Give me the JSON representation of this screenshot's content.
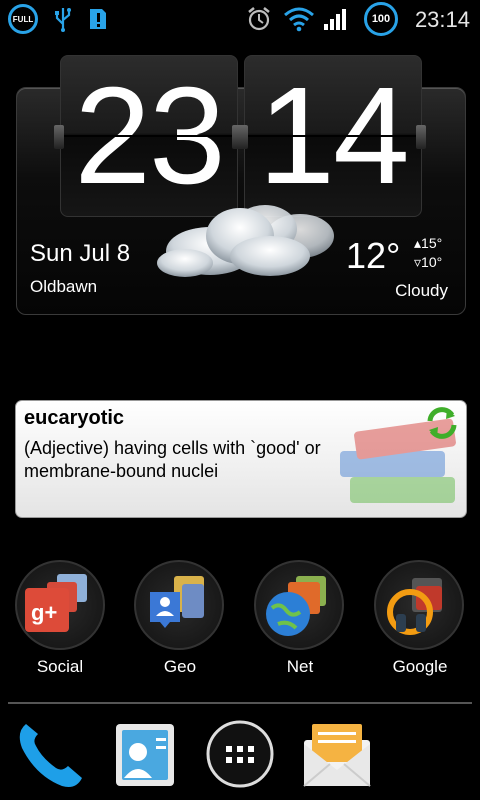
{
  "status_bar": {
    "battery_left_label": "FULL",
    "battery_right_label": "100",
    "time": "23:14",
    "icons": [
      "battery-full-icon",
      "usb-icon",
      "notification-alert-icon",
      "alarm-icon",
      "wifi-icon",
      "signal-icon"
    ]
  },
  "clock_widget": {
    "hours": "23",
    "minutes": "14",
    "date": "Sun Jul 8",
    "location": "Oldbawn",
    "temperature": "12°",
    "high": "▴15°",
    "low": "▿10°",
    "condition": "Cloudy"
  },
  "dictionary_widget": {
    "word": "eucaryotic",
    "definition": "(Adjective) having cells with `good' or membrane-bound nuclei"
  },
  "folders": [
    {
      "label": "Social",
      "icon": "social-folder-icon"
    },
    {
      "label": "Geo",
      "icon": "geo-folder-icon"
    },
    {
      "label": "Net",
      "icon": "net-folder-icon"
    },
    {
      "label": "Google",
      "icon": "google-folder-icon"
    }
  ],
  "dock": [
    "phone-icon",
    "contacts-icon",
    "app-drawer-icon",
    "messaging-icon"
  ],
  "colors": {
    "accent": "#29a3e8",
    "background": "#000000"
  }
}
